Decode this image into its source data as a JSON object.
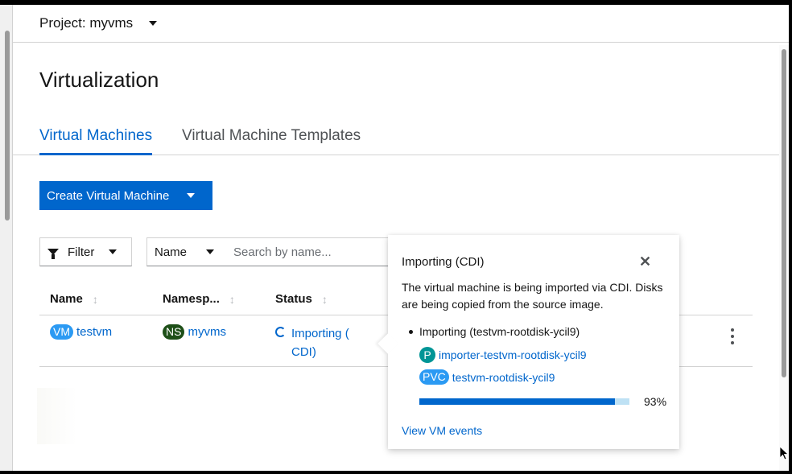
{
  "project_bar": {
    "label": "Project: myvms"
  },
  "page": {
    "title": "Virtualization"
  },
  "tabs": [
    {
      "label": "Virtual Machines",
      "active": true
    },
    {
      "label": "Virtual Machine Templates",
      "active": false
    }
  ],
  "toolbar": {
    "create_label": "Create Virtual Machine",
    "filter_label": "Filter",
    "filter_type": "Name",
    "search_placeholder": "Search by name..."
  },
  "table": {
    "columns": [
      "Name",
      "Namesp...",
      "Status"
    ],
    "rows": [
      {
        "name_badge": "VM",
        "name": "testvm",
        "ns_badge": "NS",
        "namespace": "myvms",
        "status": "Importing ( CDI)"
      }
    ]
  },
  "popover": {
    "title": "Importing (CDI)",
    "description": "The virtual machine is being imported via CDI. Disks are being copied from the source image.",
    "import_item": "Importing (testvm-rootdisk-ycil9)",
    "pod_badge": "P",
    "pod_name": "importer-testvm-rootdisk-ycil9",
    "pvc_badge": "PVC",
    "pvc_name": "testvm-rootdisk-ycil9",
    "progress_percent": 93,
    "progress_label": "93%",
    "events_link": "View VM events"
  },
  "colors": {
    "primary": "#0066cc",
    "vm_badge": "#2b9af3",
    "ns_badge": "#1e4f18",
    "pod_badge": "#009596",
    "progress_track": "#bee1f4"
  },
  "icons": [
    "caret-down-icon",
    "filter-icon",
    "sort-icon",
    "spinner-icon",
    "close-icon",
    "kebab-icon"
  ]
}
